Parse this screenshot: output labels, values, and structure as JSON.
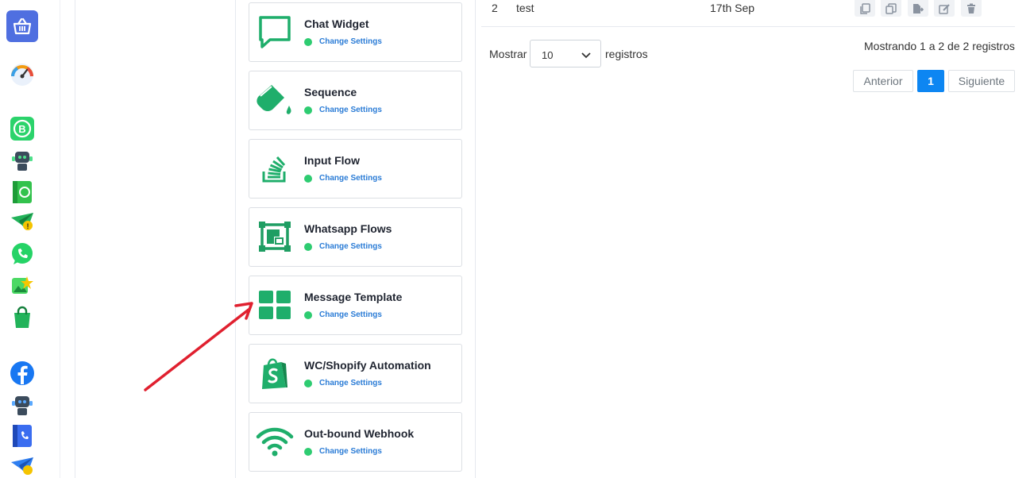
{
  "cards": [
    {
      "title": "Chat Widget",
      "link": "Change Settings",
      "icon": "chat-bubble-icon"
    },
    {
      "title": "Sequence",
      "link": "Change Settings",
      "icon": "paint-bucket-icon"
    },
    {
      "title": "Input Flow",
      "link": "Change Settings",
      "icon": "stack-overflow-icon"
    },
    {
      "title": "Whatsapp Flows",
      "link": "Change Settings",
      "icon": "frame-icon"
    },
    {
      "title": "Message Template",
      "link": "Change Settings",
      "icon": "grid-icon"
    },
    {
      "title": "WC/Shopify Automation",
      "link": "Change Settings",
      "icon": "shopify-bag-icon"
    },
    {
      "title": "Out-bound Webhook",
      "link": "Change Settings",
      "icon": "wifi-icon"
    }
  ],
  "table": {
    "row": {
      "index": "2",
      "name": "test",
      "date": "17th Sep"
    }
  },
  "length_menu": {
    "prefix": "Mostrar",
    "value": "10",
    "suffix": "registros"
  },
  "info": "Mostrando 1 a 2 de 2 registros",
  "pagination": {
    "prev": "Anterior",
    "current": "1",
    "next": "Siguiente"
  },
  "colors": {
    "accent_green": "#1fae6b",
    "link_blue": "#2b7cd6",
    "status_green": "#2ecc71",
    "page_active": "#0d86f2",
    "annotation_red": "#e0202f"
  }
}
